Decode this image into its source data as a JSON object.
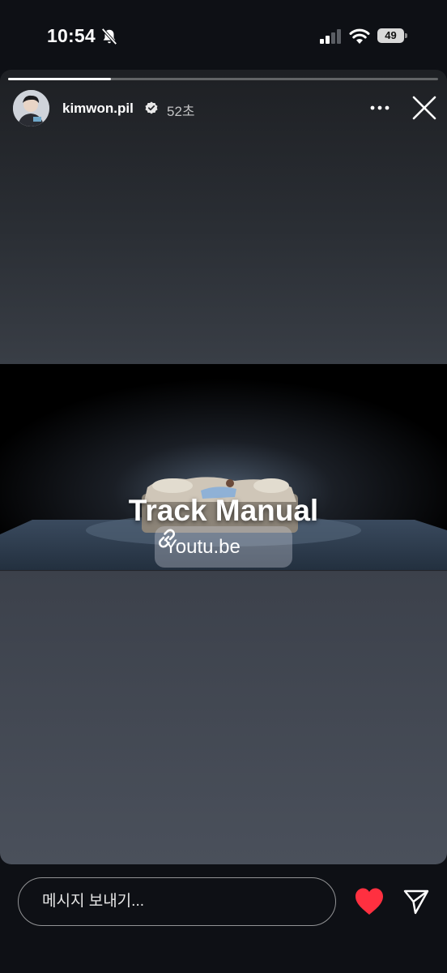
{
  "status_bar": {
    "time": "10:54",
    "battery": "49",
    "icons": [
      "bell-slash-icon",
      "signal-icon",
      "wifi-icon",
      "battery-icon"
    ]
  },
  "story": {
    "progress": 0.24,
    "username": "kimwon.pil",
    "verified": true,
    "time_ago": "52초",
    "title": "Track Manual",
    "link_label": "Youtu.be"
  },
  "bottom": {
    "placeholder": "메시지 보내기...",
    "like_color": "#ff3040"
  }
}
